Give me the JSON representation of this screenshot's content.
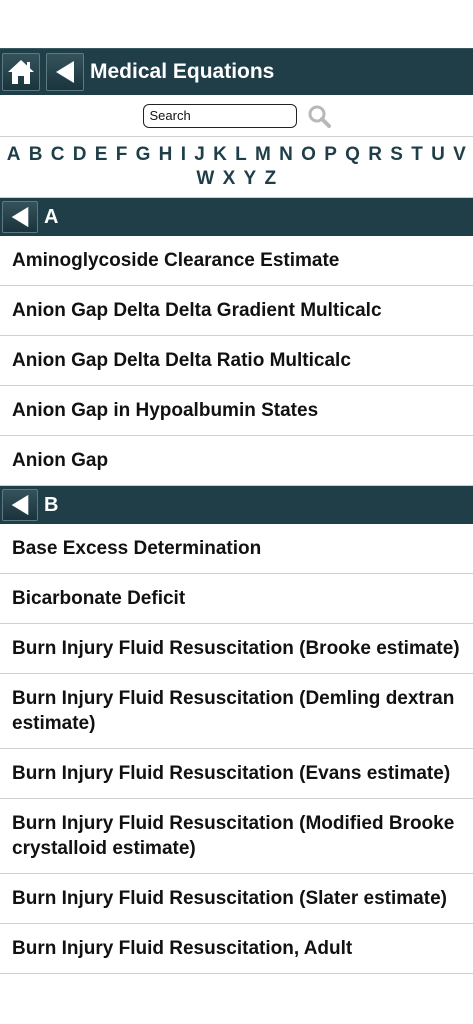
{
  "header": {
    "title": "Medical Equations",
    "home_icon": "home-icon",
    "back_icon": "back-arrow-icon"
  },
  "search": {
    "placeholder": "Search"
  },
  "alphabet": [
    "A",
    "B",
    "C",
    "D",
    "E",
    "F",
    "G",
    "H",
    "I",
    "J",
    "K",
    "L",
    "M",
    "N",
    "O",
    "P",
    "Q",
    "R",
    "S",
    "T",
    "U",
    "V",
    "W",
    "X",
    "Y",
    "Z"
  ],
  "sections": [
    {
      "letter": "A",
      "items": [
        "Aminoglycoside Clearance Estimate",
        "Anion Gap Delta Delta Gradient Multicalc",
        "Anion Gap Delta Delta Ratio Multicalc",
        "Anion Gap in Hypoalbumin States",
        "Anion Gap"
      ]
    },
    {
      "letter": "B",
      "items": [
        "Base Excess Determination",
        "Bicarbonate Deficit",
        "Burn Injury Fluid Resuscitation (Brooke estimate)",
        "Burn Injury Fluid Resuscitation (Demling dextran estimate)",
        "Burn Injury Fluid Resuscitation (Evans estimate)",
        "Burn Injury Fluid Resuscitation (Modified Brooke crystalloid estimate)",
        "Burn Injury Fluid Resuscitation (Slater estimate)",
        "Burn Injury Fluid Resuscitation, Adult"
      ]
    }
  ],
  "colors": {
    "header_bg": "#1f3e48",
    "alphabet_text": "#1f3e48"
  }
}
